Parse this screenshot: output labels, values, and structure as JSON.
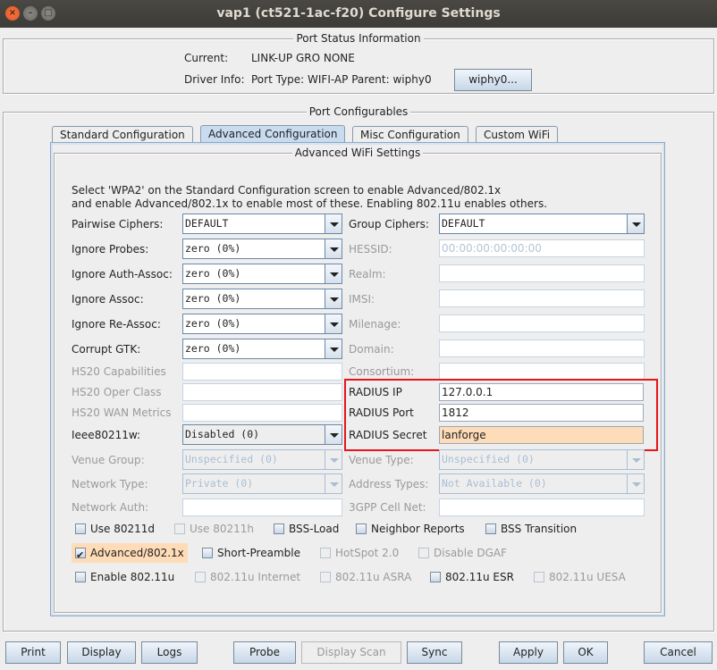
{
  "window": {
    "title": "vap1  (ct521-1ac-f20) Configure Settings",
    "controls": [
      "close",
      "minimize",
      "maximize"
    ]
  },
  "port_status": {
    "title": "Port Status Information",
    "current_label": "Current:",
    "current_value": "LINK-UP GRO  NONE",
    "driver_label": "Driver Info:",
    "driver_value": "Port Type: WIFI-AP   Parent: wiphy0",
    "parent_button": "wiphy0..."
  },
  "configurables": {
    "title": "Port Configurables",
    "tabs": [
      {
        "label": "Standard Configuration",
        "active": false
      },
      {
        "label": "Advanced Configuration",
        "active": true
      },
      {
        "label": "Misc Configuration",
        "active": false
      },
      {
        "label": "Custom WiFi",
        "active": false
      }
    ]
  },
  "advanced": {
    "title": "Advanced WiFi Settings",
    "info_line1": "Select 'WPA2' on the Standard Configuration screen to enable Advanced/802.1x",
    "info_line2": "and enable Advanced/802.1x to enable most of these. Enabling 802.11u enables others.",
    "left": {
      "pairwise": {
        "label": "Pairwise Ciphers:",
        "value": "DEFAULT"
      },
      "ignore_probes": {
        "label": "Ignore Probes:",
        "value": "zero (0%)"
      },
      "ignore_auth": {
        "label": "Ignore Auth-Assoc:",
        "value": "zero (0%)"
      },
      "ignore_assoc": {
        "label": "Ignore Assoc:",
        "value": "zero (0%)"
      },
      "ignore_reassoc": {
        "label": "Ignore Re-Assoc:",
        "value": "zero (0%)"
      },
      "corrupt_gtk": {
        "label": "Corrupt GTK:",
        "value": "zero (0%)"
      },
      "hs20_cap": {
        "label": "HS20 Capabilities",
        "value": ""
      },
      "hs20_oper": {
        "label": "HS20 Oper Class",
        "value": ""
      },
      "hs20_wan": {
        "label": "HS20 WAN Metrics",
        "value": ""
      },
      "ieee80211w": {
        "label": "Ieee80211w:",
        "value": "Disabled (0)"
      },
      "venue_group": {
        "label": "Venue Group:",
        "value": "Unspecified (0)"
      },
      "network_type": {
        "label": "Network Type:",
        "value": "Private (0)"
      },
      "network_auth": {
        "label": "Network Auth:",
        "value": ""
      }
    },
    "right": {
      "group_ciphers": {
        "label": "Group Ciphers:",
        "value": "DEFAULT"
      },
      "hessid": {
        "label": "HESSID:",
        "value": "00:00:00:00:00:00"
      },
      "realm": {
        "label": "Realm:",
        "value": ""
      },
      "imsi": {
        "label": "IMSI:",
        "value": ""
      },
      "milenage": {
        "label": "Milenage:",
        "value": ""
      },
      "domain": {
        "label": "Domain:",
        "value": ""
      },
      "consortium": {
        "label": "Consortium:",
        "value": ""
      },
      "radius_ip": {
        "label": "RADIUS IP",
        "value": "127.0.0.1"
      },
      "radius_port": {
        "label": "RADIUS Port",
        "value": "1812"
      },
      "radius_secret": {
        "label": "RADIUS Secret",
        "value": "lanforge"
      },
      "venue_type": {
        "label": "Venue Type:",
        "value": "Unspecified (0)"
      },
      "address_types": {
        "label": "Address Types:",
        "value": "Not Available (0)"
      },
      "cell_net": {
        "label": "3GPP Cell Net:",
        "value": ""
      }
    },
    "checkboxes": [
      {
        "label": "Use 80211d",
        "checked": false,
        "enabled": true
      },
      {
        "label": "Use 80211h",
        "checked": false,
        "enabled": false
      },
      {
        "label": "BSS-Load",
        "checked": false,
        "enabled": true
      },
      {
        "label": "Neighbor Reports",
        "checked": false,
        "enabled": true
      },
      {
        "label": "BSS Transition",
        "checked": false,
        "enabled": true
      },
      {
        "label": "Advanced/802.1x",
        "checked": true,
        "enabled": true
      },
      {
        "label": "Short-Preamble",
        "checked": false,
        "enabled": true
      },
      {
        "label": "HotSpot 2.0",
        "checked": false,
        "enabled": false
      },
      {
        "label": "Disable DGAF",
        "checked": false,
        "enabled": false
      },
      {
        "label": "Enable 802.11u",
        "checked": false,
        "enabled": true
      },
      {
        "label": "802.11u Internet",
        "checked": false,
        "enabled": false
      },
      {
        "label": "802.11u ASRA",
        "checked": false,
        "enabled": false
      },
      {
        "label": "802.11u ESR",
        "checked": false,
        "enabled": true
      },
      {
        "label": "802.11u UESA",
        "checked": false,
        "enabled": false
      }
    ]
  },
  "buttons": {
    "print": "Print",
    "display": "Display",
    "logs": "Logs",
    "probe": "Probe",
    "display_scan": "Display Scan",
    "sync": "Sync",
    "apply": "Apply",
    "ok": "OK",
    "cancel": "Cancel"
  },
  "colors": {
    "highlight": "#ffdcb8",
    "annotation_red": "#e8141a",
    "active_tab": "#c9dcef"
  }
}
